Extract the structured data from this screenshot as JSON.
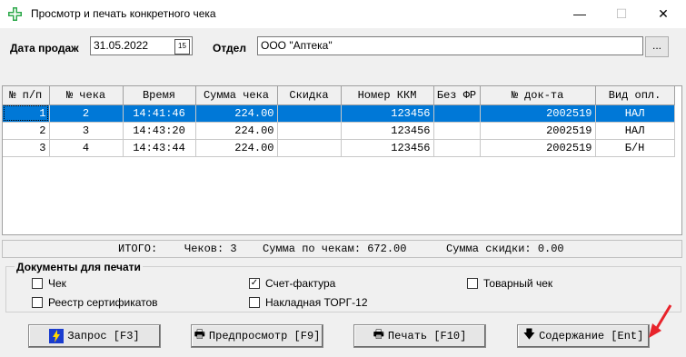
{
  "window": {
    "title": "Просмотр и печать конкретного чека",
    "min": "—",
    "max": "☐",
    "close": "✕"
  },
  "filters": {
    "date_label": "Дата продаж",
    "date_value": "31.05.2022",
    "calendar_glyph": "15",
    "dept_label": "Отдел",
    "dept_value": "ООО \"Аптека\"",
    "dots": "..."
  },
  "table": {
    "headers": [
      "№ п/п",
      "№ чека",
      "Время",
      "Сумма чека",
      "Скидка",
      "Номер ККМ",
      "Без ФР",
      "№ док-та",
      "Вид опл."
    ],
    "rows": [
      [
        "1",
        "2",
        "14:41:46",
        "224.00",
        "",
        "123456",
        "",
        "2002519",
        "НАЛ"
      ],
      [
        "2",
        "3",
        "14:43:20",
        "224.00",
        "",
        "123456",
        "",
        "2002519",
        "НАЛ"
      ],
      [
        "3",
        "4",
        "14:43:44",
        "224.00",
        "",
        "123456",
        "",
        "2002519",
        "Б/Н"
      ]
    ],
    "selected_row": 0
  },
  "totals": {
    "itogo": "ИТОГО:",
    "checks": "Чеков: 3",
    "sum": "Сумма по чекам: 672.00",
    "discount": "Сумма скидки: 0.00"
  },
  "documents": {
    "title": "Документы для печати",
    "items": [
      {
        "label": "Чек",
        "checked": false
      },
      {
        "label": "Счет-фактура",
        "checked": true
      },
      {
        "label": "Товарный чек",
        "checked": false
      },
      {
        "label": "Реестр сертификатов",
        "checked": false
      },
      {
        "label": "Накладная ТОРГ-12",
        "checked": false
      }
    ]
  },
  "buttons": {
    "request": "Запрос [F3]",
    "preview": "Предпросмотр [F9]",
    "print": "Печать [F10]",
    "contents": "Содержание [Ent]"
  },
  "colors": {
    "selection": "#0078d7",
    "arrow": "#e8232b"
  }
}
